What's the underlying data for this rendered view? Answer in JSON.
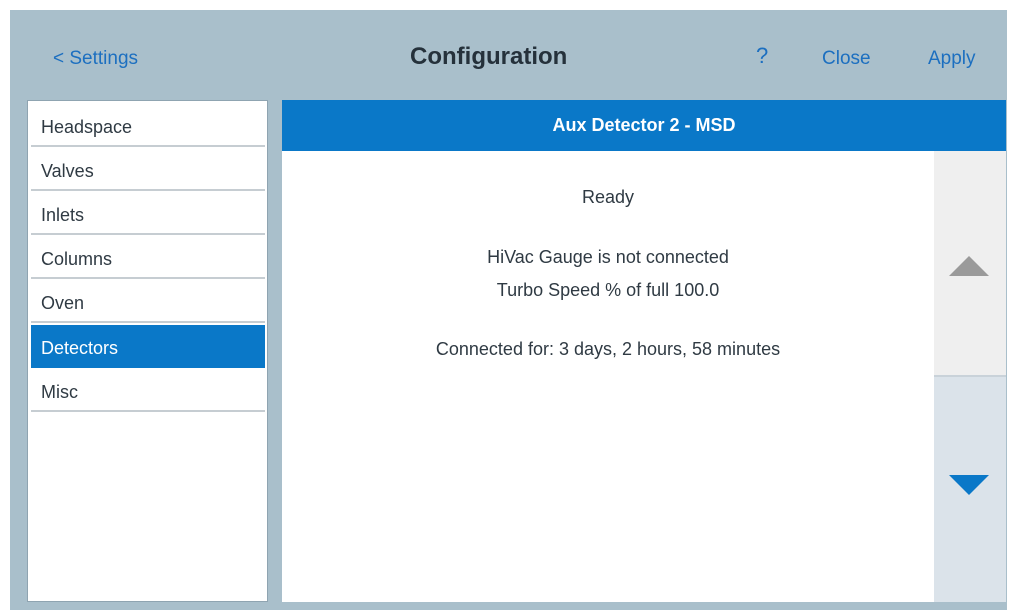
{
  "header": {
    "back_label": "< Settings",
    "title": "Configuration",
    "help_label": "?",
    "close_label": "Close",
    "apply_label": "Apply"
  },
  "sidebar": {
    "items": [
      {
        "label": "Headspace",
        "active": false
      },
      {
        "label": "Valves",
        "active": false
      },
      {
        "label": "Inlets",
        "active": false
      },
      {
        "label": "Columns",
        "active": false
      },
      {
        "label": "Oven",
        "active": false
      },
      {
        "label": "Detectors",
        "active": true
      },
      {
        "label": "Misc",
        "active": false
      }
    ]
  },
  "panel": {
    "title": "Aux Detector 2 - MSD",
    "status": "Ready",
    "gauge": "HiVac Gauge is not connected",
    "turbo": "Turbo Speed % of full  100.0",
    "connected": "Connected for: 3 days, 2 hours, 58 minutes"
  },
  "scroll": {
    "up_icon": "triangle-up-icon",
    "down_icon": "triangle-down-icon"
  },
  "colors": {
    "frame": "#a9bfcb",
    "accent": "#0a78c8",
    "link": "#1c6fc0",
    "disabled_arrow": "#9a9a9a"
  }
}
